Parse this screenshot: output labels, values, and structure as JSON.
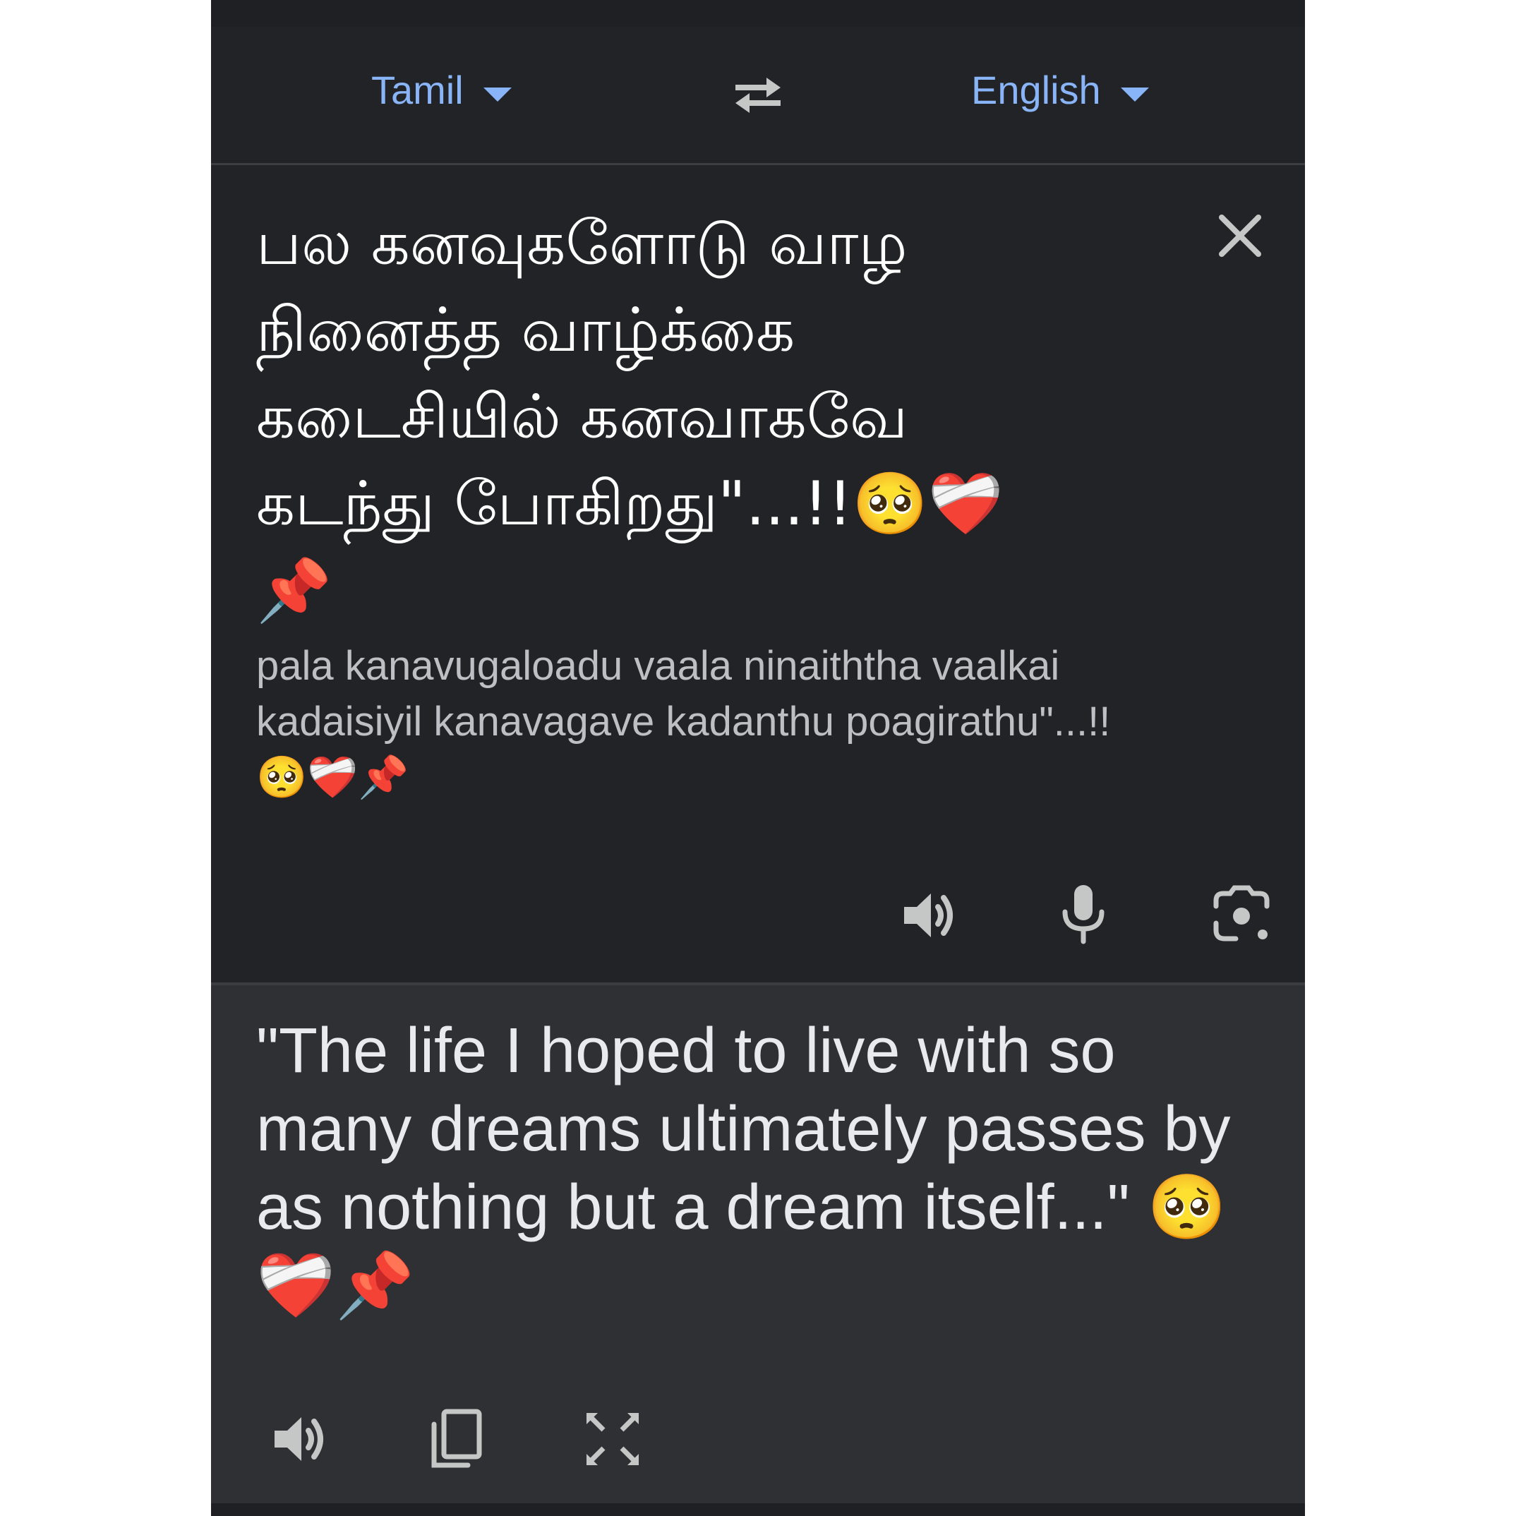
{
  "language_bar": {
    "source_language": "Tamil",
    "target_language": "English"
  },
  "source": {
    "text": "பல கனவுகளோடு வாழ நினைத்த வாழ்க்கை கடைசியில் கனவாகவே கடந்து போகிறது\"...!!🥺❤️‍🩹📌",
    "transliteration": "pala kanavugaloadu vaala ninaiththa vaalkai kadaisiyil kanavagave kadanthu poagirathu\"...!!🥺❤️‍🩹📌"
  },
  "translation": {
    "text": "\"The life I hoped to live with so many dreams ultimately passes by as nothing but a dream itself...\" 🥺❤️‍🩹📌"
  },
  "icons": {
    "swap": "swap-languages-icon",
    "close": "close-icon",
    "source_listen": "speaker-icon",
    "mic": "microphone-icon",
    "camera": "camera-icon",
    "target_listen": "speaker-icon",
    "copy": "copy-icon",
    "fullscreen": "fullscreen-icon"
  },
  "colors": {
    "background": "#222326",
    "target_background": "#2f3034",
    "accent": "#8ab4f8",
    "text": "#ffffff",
    "icon": "#c4c7c5"
  }
}
